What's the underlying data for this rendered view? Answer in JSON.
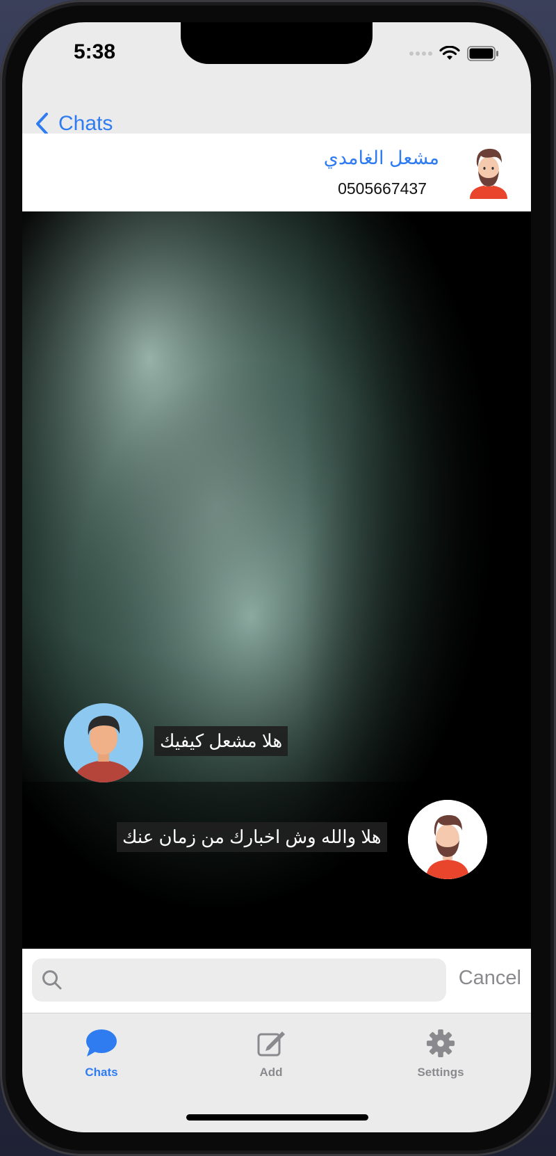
{
  "status_bar": {
    "time": "5:38"
  },
  "nav": {
    "back_label": "Chats"
  },
  "contact": {
    "name": "مشعل الغامدي",
    "phone": "0505667437"
  },
  "messages": [
    {
      "text": "هلا مشعل كيفيك",
      "sender": "me"
    },
    {
      "text": "هلا والله وش اخبارك من زمان عنك",
      "sender": "contact"
    }
  ],
  "search": {
    "value": "",
    "placeholder": "",
    "cancel_label": "Cancel"
  },
  "tabs": [
    {
      "label": "Chats",
      "icon": "chat-bubble-icon",
      "active": true
    },
    {
      "label": "Add",
      "icon": "compose-icon",
      "active": false
    },
    {
      "label": "Settings",
      "icon": "gear-icon",
      "active": false
    }
  ],
  "colors": {
    "accent": "#2f7bf0",
    "inactive": "#8a8a8e"
  }
}
